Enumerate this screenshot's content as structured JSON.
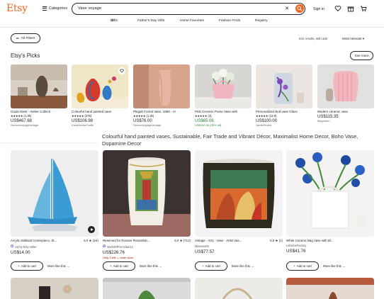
{
  "header": {
    "logo": "Etsy",
    "categories_label": "Categories",
    "search_value": "Vase voyage",
    "signin_label": "Sign in",
    "accent_color": "#f1641e"
  },
  "subnav": {
    "items": [
      "Gifts",
      "Father's Day Gifts",
      "Home Favorites",
      "Fashion Finds",
      "Registry"
    ]
  },
  "filters": {
    "all_filters_label": "All Filters",
    "results_text": "541 results, with ads",
    "sort_label": "Most relevant"
  },
  "picks": {
    "title": "Etsy's Picks",
    "see_more_label": "See more",
    "items": [
      {
        "title": "Guido Niest - Atelier Collecti",
        "stars": "★★★★★",
        "reviews": "(1.3k)",
        "price": "US$467.68",
        "shop": "Secondvoyagevintage",
        "sale": false,
        "old": ""
      },
      {
        "title": "Colourful hand painted vase",
        "stars": "★★★★★",
        "reviews": "(276)",
        "price": "US$106.98",
        "shop": "KaraKorumCrafts",
        "sale": false,
        "old": ""
      },
      {
        "title": "Plegah Forest Vase, 1960 - Vi",
        "stars": "★★★★★",
        "reviews": "(1.3k)",
        "price": "US$76.00",
        "shop": "Secondvoyagevintage",
        "sale": false,
        "old": ""
      },
      {
        "title": "Pink Ceramic Purse Vase with",
        "stars": "★★★★★",
        "reviews": "(4)",
        "price": "US$65.06",
        "shop": "",
        "sale": true,
        "old": "US$100.09 (35% off)"
      },
      {
        "title": "Personalized Bud vase Glass",
        "stars": "★★★★★",
        "reviews": "(13.8)",
        "price": "US$100.00",
        "shop": "JamieStudio",
        "sale": false,
        "old": ""
      },
      {
        "title": "Modern ceramic vase",
        "stars": "",
        "reviews": "",
        "price": "US$115.35",
        "shop": "Magnalen",
        "sale": false,
        "old": ""
      }
    ]
  },
  "tooltip": {
    "text": "Colourful hand painted vases, Sustainable, Fair Trade and Vibrant Décor, Maximalist Home Decor, Boho Vase, Dopamine Decor"
  },
  "listings": [
    {
      "title": "Acrylic Sailboat Centerpiece, St...",
      "rating": "5.0 ★ (1K)",
      "seller": "Ad by Etsy seller",
      "price": "US$14.00",
      "urgent": "",
      "add_label": "Add to cart",
      "more_label": "More like this"
    },
    {
      "title": "Reserved for Roxane Rosenthal...",
      "rating": "5.0 ★ (712)",
      "seller": "WorldOfPorcelain14",
      "price": "US$226.76",
      "urgent": "Only 1 left — order soon",
      "add_label": "Add to cart",
      "more_label": "More like this"
    },
    {
      "title": "Vintage - XXL - Vase - Artist Vas...",
      "rating": "5.0 ★ (1)",
      "seller": "Maisonarts",
      "price": "US$77.57",
      "urgent": "",
      "add_label": "Add to cart",
      "more_label": "More like this"
    },
    {
      "title": "White Ceramic Bag Vase with Bl...",
      "rating": "",
      "seller": "LahomeFactory",
      "price": "US$41.76",
      "urgent": "",
      "add_label": "Add to cart",
      "more_label": "More like this"
    }
  ]
}
